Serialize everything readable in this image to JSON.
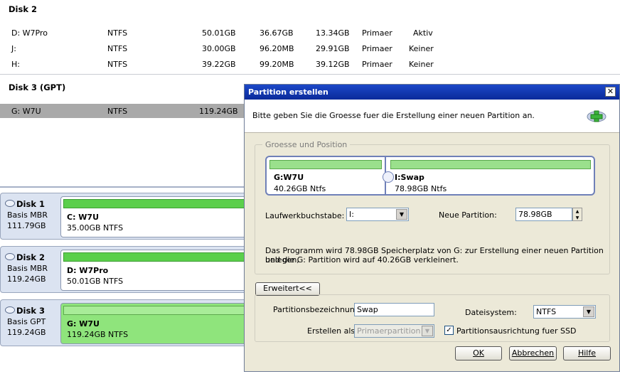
{
  "disk2": {
    "header": "Disk 2",
    "rows": [
      {
        "name": "D: W7Pro",
        "fs": "NTFS",
        "size": "50.01GB",
        "used": "36.67GB",
        "free": "13.34GB",
        "type": "Primaer",
        "status": "Aktiv"
      },
      {
        "name": "J:",
        "fs": "NTFS",
        "size": "30.00GB",
        "used": "96.20MB",
        "free": "29.91GB",
        "type": "Primaer",
        "status": "Keiner"
      },
      {
        "name": "H:",
        "fs": "NTFS",
        "size": "39.22GB",
        "used": "99.20MB",
        "free": "39.12GB",
        "type": "Primaer",
        "status": "Keiner"
      }
    ]
  },
  "disk3": {
    "header": "Disk 3 (GPT)",
    "rows": [
      {
        "name": "G: W7U",
        "fs": "NTFS",
        "size": "119.24GB"
      }
    ]
  },
  "disk_map": [
    {
      "name": "Disk 1",
      "type": "Basis MBR",
      "size": "111.79GB",
      "part_label": "C: W7U",
      "part_info": "35.00GB NTFS"
    },
    {
      "name": "Disk 2",
      "type": "Basis MBR",
      "size": "119.24GB",
      "part_label": "D: W7Pro",
      "part_info": "50.01GB NTFS"
    },
    {
      "name": "Disk 3",
      "type": "Basis GPT",
      "size": "119.24GB",
      "part_label": "G: W7U",
      "part_info": "119.24GB NTFS"
    }
  ],
  "dialog": {
    "title": "Partition erstellen",
    "close_glyph": "✕",
    "instruction": "Bitte geben Sie die Groesse fuer die Erstellung einer neuen Partition an.",
    "group_label": "Groesse und Position",
    "partition_left": {
      "name": "G:W7U",
      "info": "40.26GB Ntfs"
    },
    "partition_right": {
      "name": "I:Swap",
      "info": "78.98GB Ntfs"
    },
    "drive_letter_label": "Laufwerkbuchstabe:",
    "drive_letter_value": "I:",
    "new_partition_label": "Neue Partition:",
    "new_partition_value": "78.98GB",
    "info_line1": "Das Programm wird  78.98GB Speicherplatz von G: zur Erstellung einer neuen Partition belegen,",
    "info_line2": "und die G: Partition wird auf 40.26GB verkleinert.",
    "advanced_button": "Erweitert<<",
    "label_label": "Partitionsbezeichnung:",
    "label_value": "Swap",
    "filesystem_label": "Dateisystem:",
    "filesystem_value": "NTFS",
    "create_as_label": "Erstellen als:",
    "create_as_value": "Primaerpartition",
    "ssd_align_label": "Partitionsausrichtung fuer SSD",
    "ssd_align_checked": "✓",
    "ok": "OK",
    "cancel": "Abbrechen",
    "help": "Hilfe"
  }
}
